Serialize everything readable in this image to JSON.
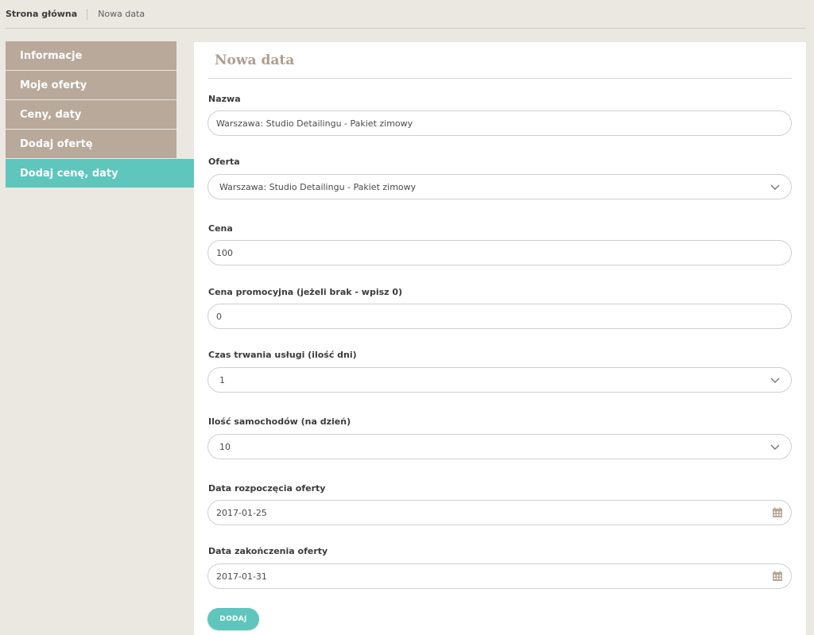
{
  "breadcrumb": {
    "home": "Strona główna",
    "current": "Nowa data"
  },
  "sidebar": {
    "items": [
      {
        "label": "Informacje"
      },
      {
        "label": "Moje oferty"
      },
      {
        "label": "Ceny, daty"
      },
      {
        "label": "Dodaj ofertę"
      },
      {
        "label": "Dodaj cenę, daty",
        "active": true
      }
    ]
  },
  "form": {
    "title": "Nowa data",
    "nazwa": {
      "label": "Nazwa",
      "value": "Warszawa: Studio Detailingu - Pakiet zimowy"
    },
    "oferta": {
      "label": "Oferta",
      "value": "Warszawa: Studio Detailingu - Pakiet zimowy"
    },
    "cena": {
      "label": "Cena",
      "value": "100"
    },
    "cena_promocyjna": {
      "label": "Cena promocyjna (jeżeli brak - wpisz 0)",
      "value": "0"
    },
    "czas_trwania": {
      "label": "Czas trwania usługi (ilość dni)",
      "value": "1"
    },
    "ilosc_samochodow": {
      "label": "Ilość samochodów (na dzień)",
      "value": "10"
    },
    "data_rozpoczecia": {
      "label": "Data rozpoczęcia oferty",
      "value": "2017-01-25"
    },
    "data_zakonczenia": {
      "label": "Data zakończenia oferty",
      "value": "2017-01-31"
    },
    "submit_label": "DODAJ"
  },
  "colors": {
    "accent": "#5ec6bd",
    "sidebar": "#b9a99b",
    "title": "#b09d8d",
    "background": "#ebe7e1"
  },
  "icons": {
    "select": "chevron-down-icon",
    "date": "calendar-icon"
  }
}
